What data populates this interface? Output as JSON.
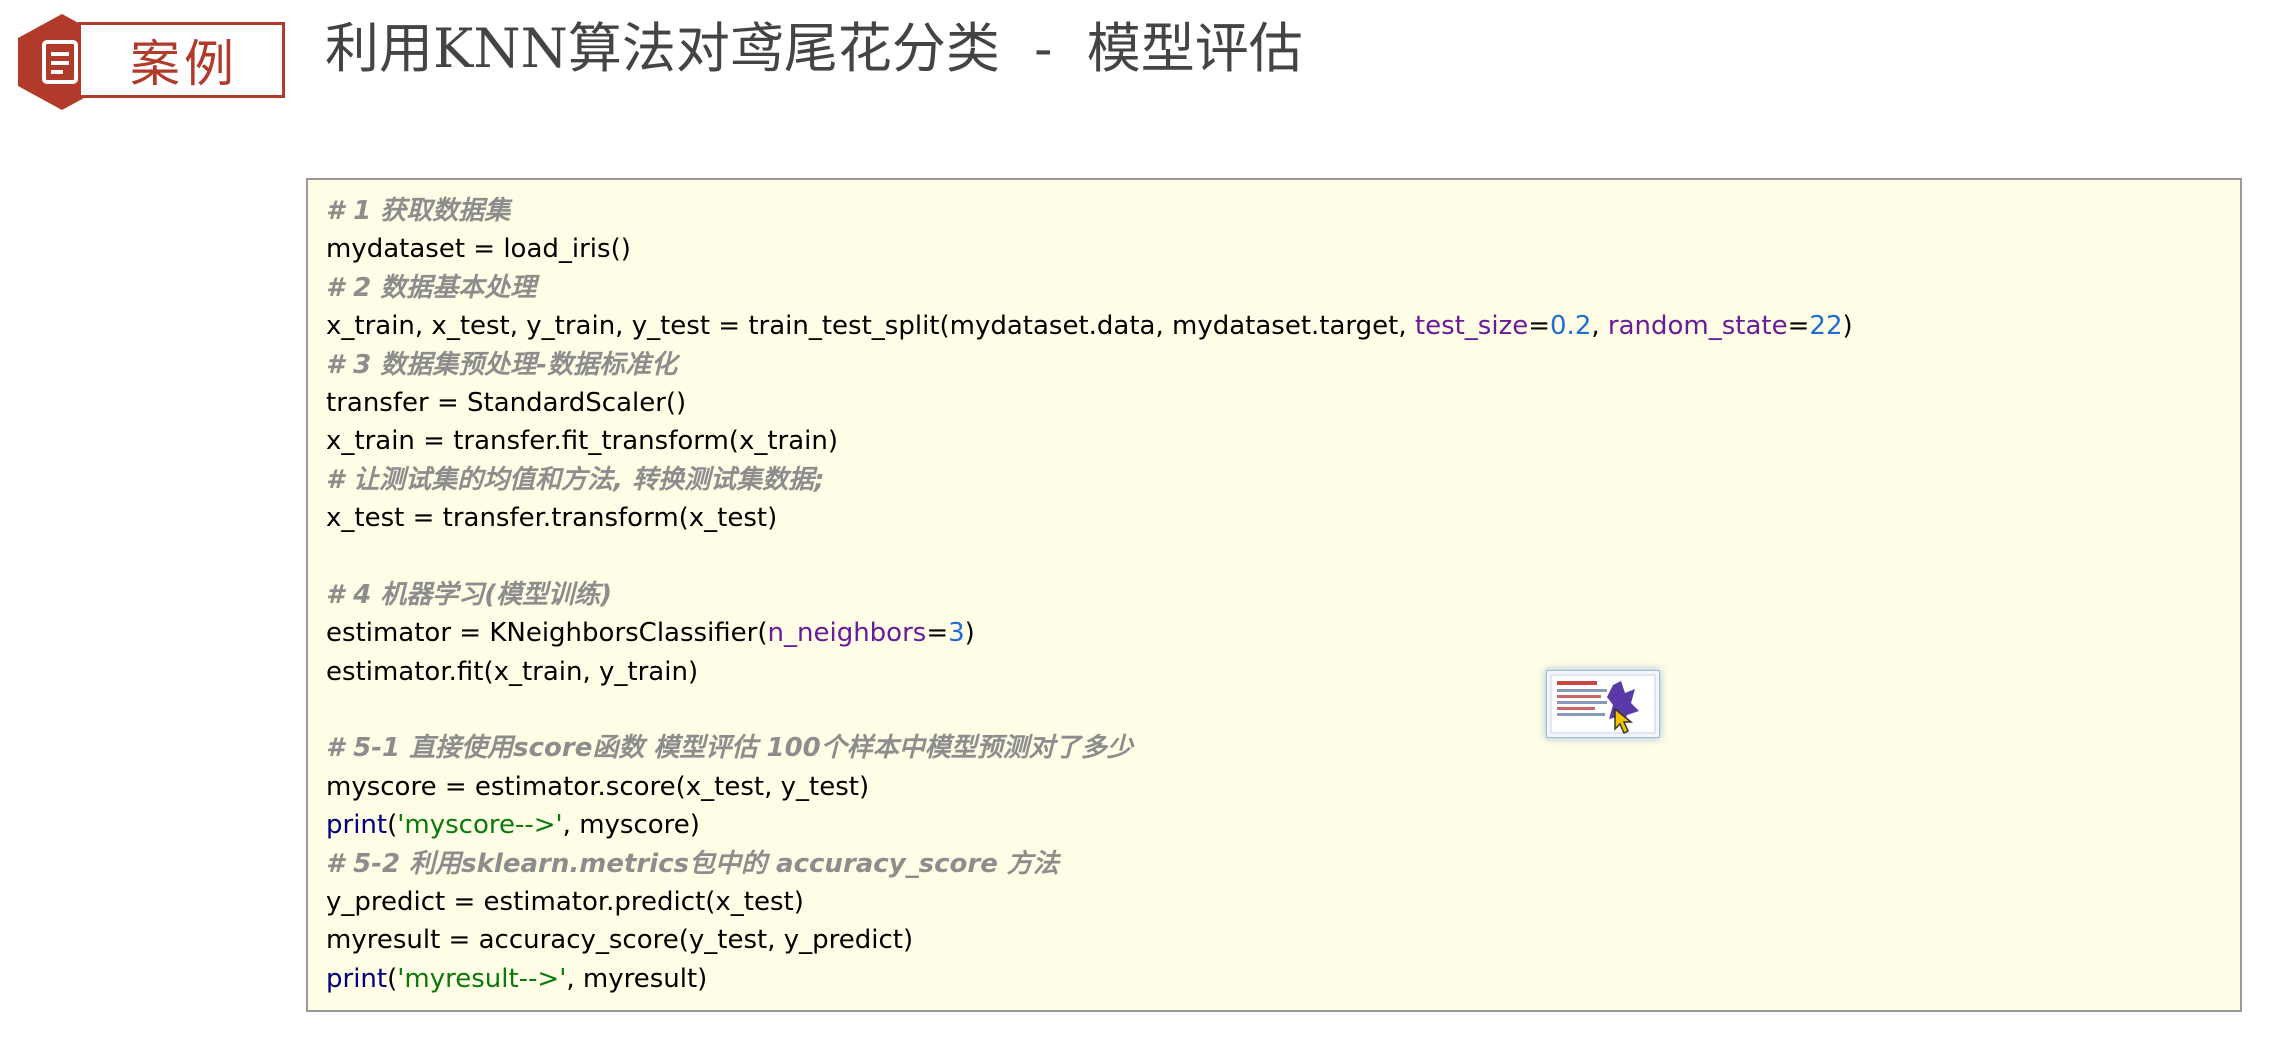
{
  "badge": {
    "label": "案例",
    "icon": "document-icon",
    "color": "#b23a2b"
  },
  "title": "利用KNN算法对鸢尾花分类  -  模型评估",
  "code": {
    "c1": "# 1 获取数据集",
    "l1": "mydataset = load_iris()",
    "c2": "# 2 数据基本处理",
    "l2a": "x_train, x_test, y_train, y_test = train_test_split(mydataset.data, mydataset.target, ",
    "l2_kw1": "test_size",
    "l2_eq1": "=",
    "l2_num1": "0.2",
    "l2_sep": ", ",
    "l2_kw2": "random_state",
    "l2_eq2": "=",
    "l2_num2": "22",
    "l2_end": ")",
    "c3": "# 3 数据集预处理-数据标准化",
    "l3": "transfer = StandardScaler()",
    "l4": "x_train = transfer.fit_transform(x_train)",
    "c4": "# 让测试集的均值和方法, 转换测试集数据;",
    "l5": "x_test = transfer.transform(x_test)",
    "c5": "# 4 机器学习(模型训练)",
    "l6a": "estimator = KNeighborsClassifier(",
    "l6_kw": "n_neighbors",
    "l6_eq": "=",
    "l6_num": "3",
    "l6_end": ")",
    "l7": "estimator.fit(x_train, y_train)",
    "c6": "# 5-1 直接使用score函数 模型评估 100个样本中模型预测对了多少",
    "l8": "myscore = estimator.score(x_test, y_test)",
    "l9_fn": "print",
    "l9_open": "(",
    "l9_str": "'myscore-->'",
    "l9_rest": ", myscore)",
    "c7": "# 5-2 利用sklearn.metrics包中的 accuracy_score 方法",
    "l10": "y_predict = estimator.predict(x_test)",
    "l11": "myresult = accuracy_score(y_test, y_predict)",
    "l12_fn": "print",
    "l12_open": "(",
    "l12_str": "'myresult-->'",
    "l12_rest": ", myresult)"
  },
  "colors": {
    "comment": "#8d8d8d",
    "keyword_arg": "#6a1b9a",
    "number": "#1e6dd8",
    "builtin": "#000080",
    "string": "#0a7a0a",
    "code_background": "#fffde5"
  },
  "thumbnail": {
    "icon": "slide-thumbnail-icon",
    "cursor": "pointer-cursor-icon"
  }
}
